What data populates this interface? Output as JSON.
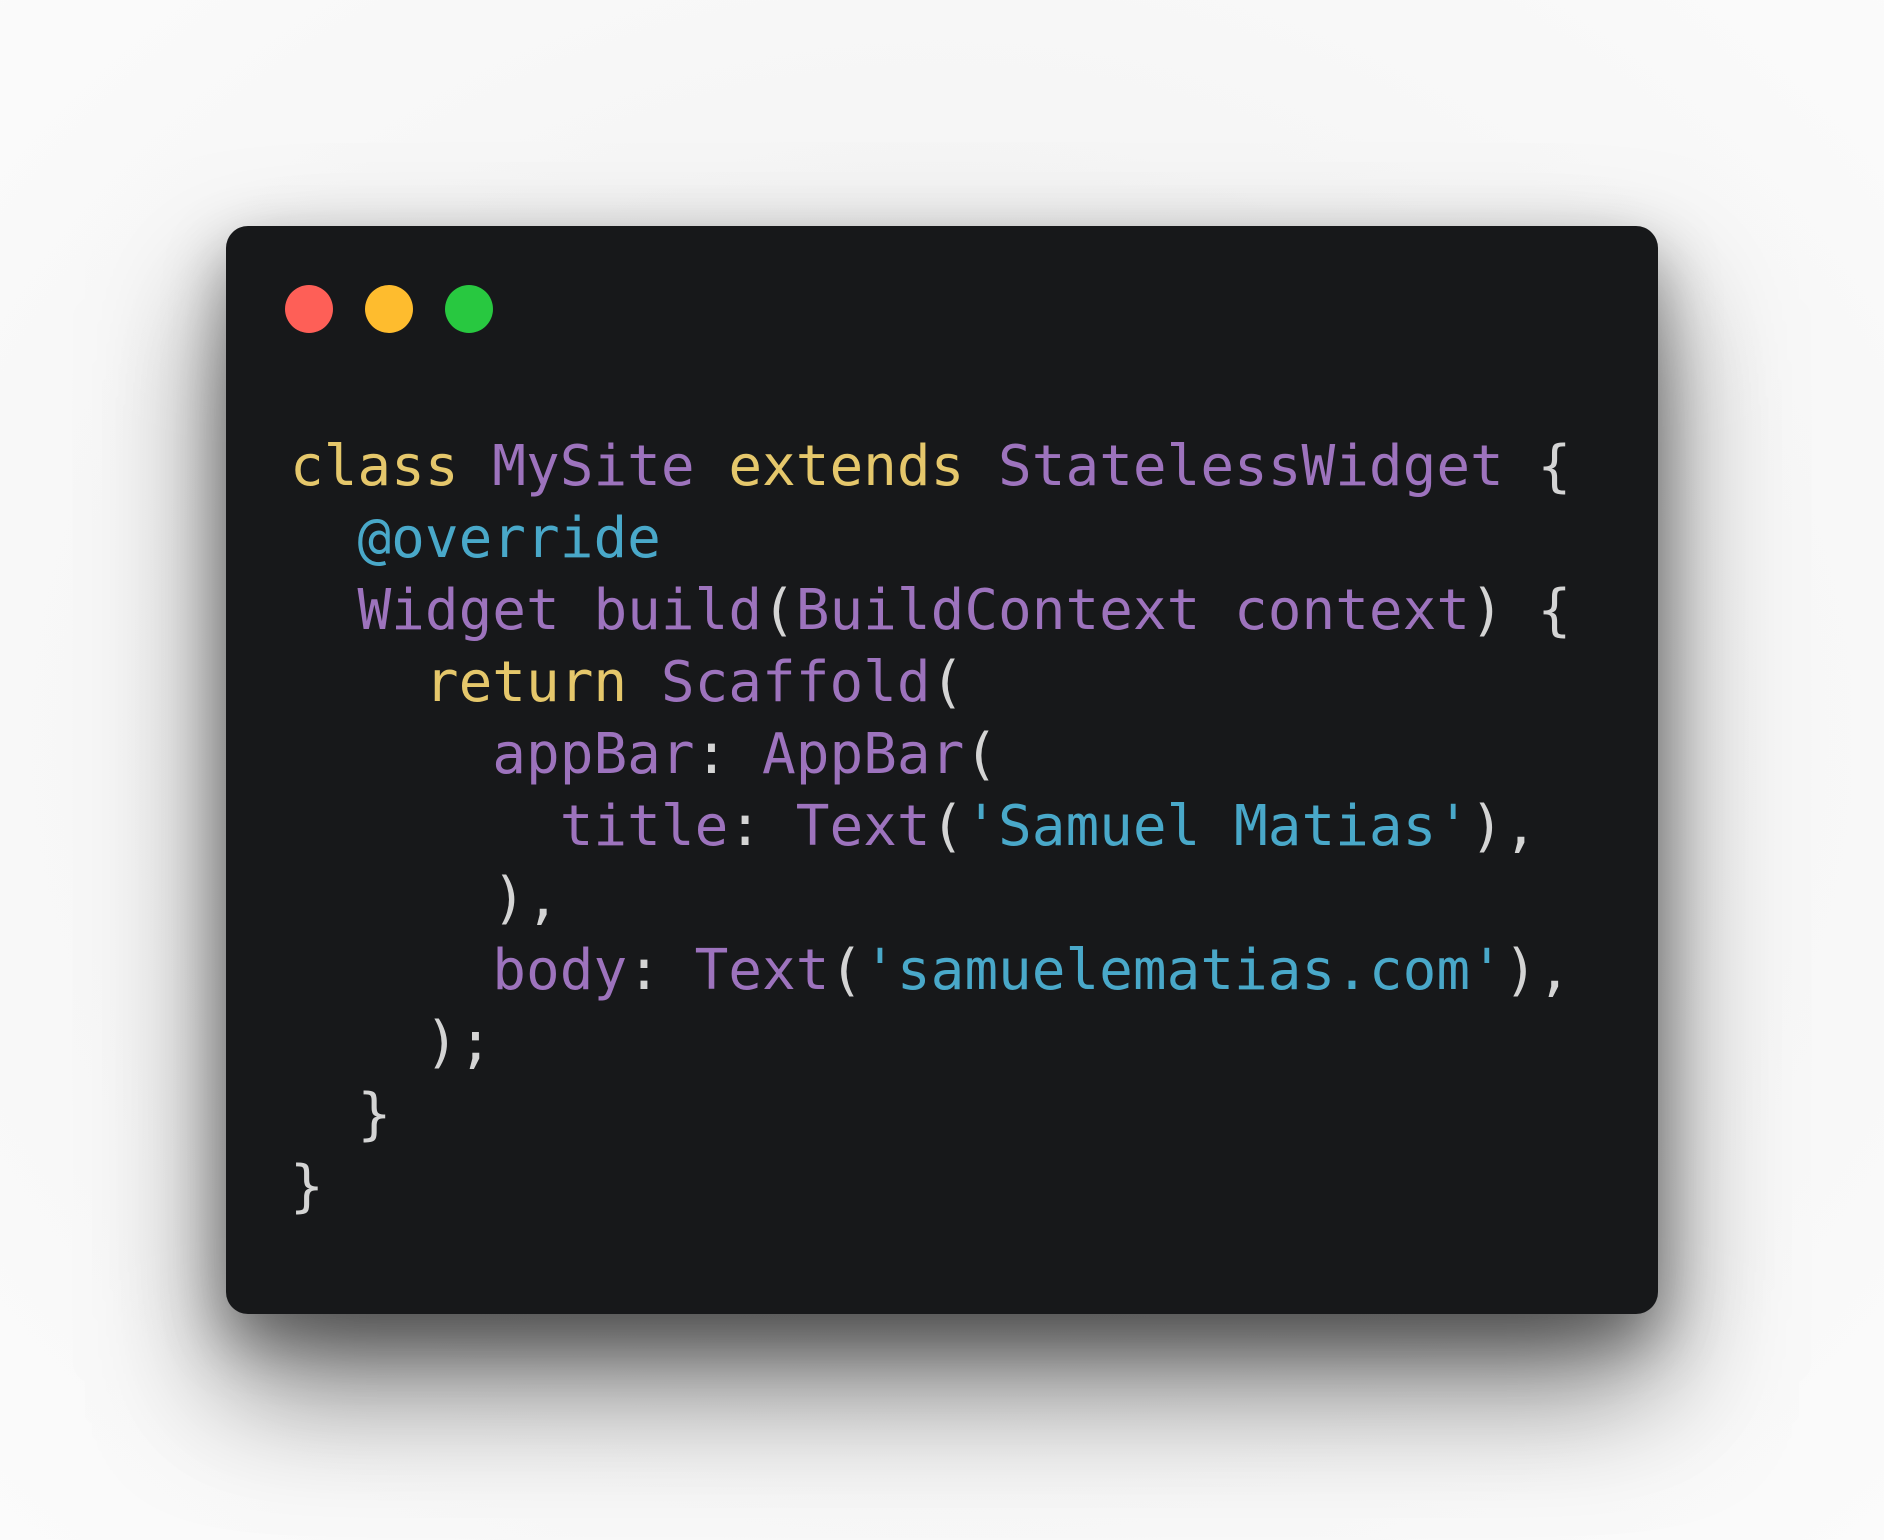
{
  "window": {
    "controls": {
      "close": {
        "icon": "close-dot-icon",
        "color": "#fe5f57"
      },
      "minimize": {
        "icon": "minimize-dot-icon",
        "color": "#febc2e"
      },
      "maximize": {
        "icon": "maximize-dot-icon",
        "color": "#28c840"
      }
    },
    "background": "#17181a"
  },
  "syntax_colors": {
    "keyword": "#e5c76b",
    "type": "#9d73bd",
    "annotation": "#49a8c9",
    "string": "#49a8c9",
    "punctuation": "#d4d4d4"
  },
  "code": {
    "lines": [
      {
        "indent": 0,
        "tokens": [
          {
            "text": "class",
            "kind": "keyword"
          },
          {
            "text": " ",
            "kind": "punctuation"
          },
          {
            "text": "MySite",
            "kind": "type"
          },
          {
            "text": " ",
            "kind": "punctuation"
          },
          {
            "text": "extends",
            "kind": "keyword"
          },
          {
            "text": " ",
            "kind": "punctuation"
          },
          {
            "text": "StatelessWidget",
            "kind": "type"
          },
          {
            "text": " {",
            "kind": "punctuation"
          }
        ]
      },
      {
        "indent": 1,
        "tokens": [
          {
            "text": "@override",
            "kind": "annotation"
          }
        ]
      },
      {
        "indent": 1,
        "tokens": [
          {
            "text": "Widget",
            "kind": "type"
          },
          {
            "text": " ",
            "kind": "punctuation"
          },
          {
            "text": "build",
            "kind": "type"
          },
          {
            "text": "(",
            "kind": "punctuation"
          },
          {
            "text": "BuildContext",
            "kind": "type"
          },
          {
            "text": " ",
            "kind": "punctuation"
          },
          {
            "text": "context",
            "kind": "type"
          },
          {
            "text": ") {",
            "kind": "punctuation"
          }
        ]
      },
      {
        "indent": 2,
        "tokens": [
          {
            "text": "return",
            "kind": "keyword"
          },
          {
            "text": " ",
            "kind": "punctuation"
          },
          {
            "text": "Scaffold",
            "kind": "type"
          },
          {
            "text": "(",
            "kind": "punctuation"
          }
        ]
      },
      {
        "indent": 3,
        "tokens": [
          {
            "text": "appBar",
            "kind": "type"
          },
          {
            "text": ": ",
            "kind": "punctuation"
          },
          {
            "text": "AppBar",
            "kind": "type"
          },
          {
            "text": "(",
            "kind": "punctuation"
          }
        ]
      },
      {
        "indent": 4,
        "tokens": [
          {
            "text": "title",
            "kind": "type"
          },
          {
            "text": ": ",
            "kind": "punctuation"
          },
          {
            "text": "Text",
            "kind": "type"
          },
          {
            "text": "(",
            "kind": "punctuation"
          },
          {
            "text": "'Samuel Matias'",
            "kind": "string"
          },
          {
            "text": "),",
            "kind": "punctuation"
          }
        ]
      },
      {
        "indent": 3,
        "tokens": [
          {
            "text": "),",
            "kind": "punctuation"
          }
        ]
      },
      {
        "indent": 3,
        "tokens": [
          {
            "text": "body",
            "kind": "type"
          },
          {
            "text": ": ",
            "kind": "punctuation"
          },
          {
            "text": "Text",
            "kind": "type"
          },
          {
            "text": "(",
            "kind": "punctuation"
          },
          {
            "text": "'samuelematias.com'",
            "kind": "string"
          },
          {
            "text": "),",
            "kind": "punctuation"
          }
        ]
      },
      {
        "indent": 2,
        "tokens": [
          {
            "text": ");",
            "kind": "punctuation"
          }
        ]
      },
      {
        "indent": 1,
        "tokens": [
          {
            "text": "}",
            "kind": "punctuation"
          }
        ]
      },
      {
        "indent": 0,
        "tokens": [
          {
            "text": "}",
            "kind": "punctuation"
          }
        ]
      }
    ]
  }
}
